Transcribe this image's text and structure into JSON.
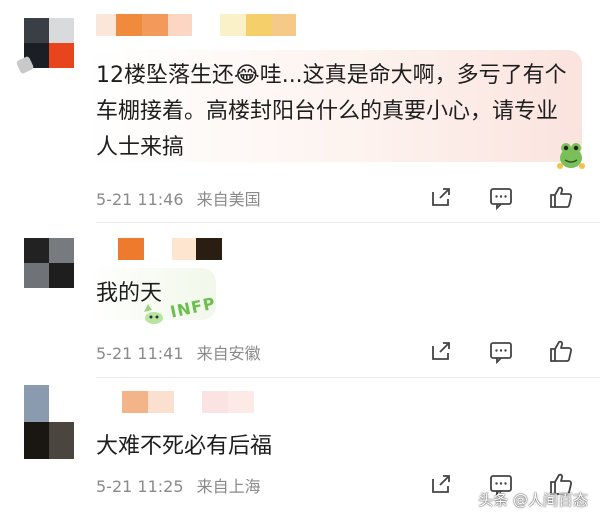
{
  "comments": [
    {
      "text": "12楼坠落生还😂哇...这真是命大啊，多亏了有个车棚接着。高楼封阳台什么的真要小心，请专业人士来搞",
      "time": "5-21 11:46",
      "location": "来自美国"
    },
    {
      "text": "我的天",
      "sticker_label": "INFP",
      "time": "5-21 11:41",
      "location": "来自安徽"
    },
    {
      "text": "大难不死必有后福",
      "time": "5-21 11:25",
      "location": "来自上海"
    }
  ],
  "actions": {
    "share_icon": "share-icon",
    "reply_icon": "comment-icon",
    "like_icon": "thumbs-up-icon"
  },
  "watermark": "头条 @人间百态",
  "colors": {
    "bubble1": "#fdecea",
    "bubble2": "#eef7e6",
    "meta_text": "#8a8a8a",
    "icon_stroke": "#444444"
  }
}
